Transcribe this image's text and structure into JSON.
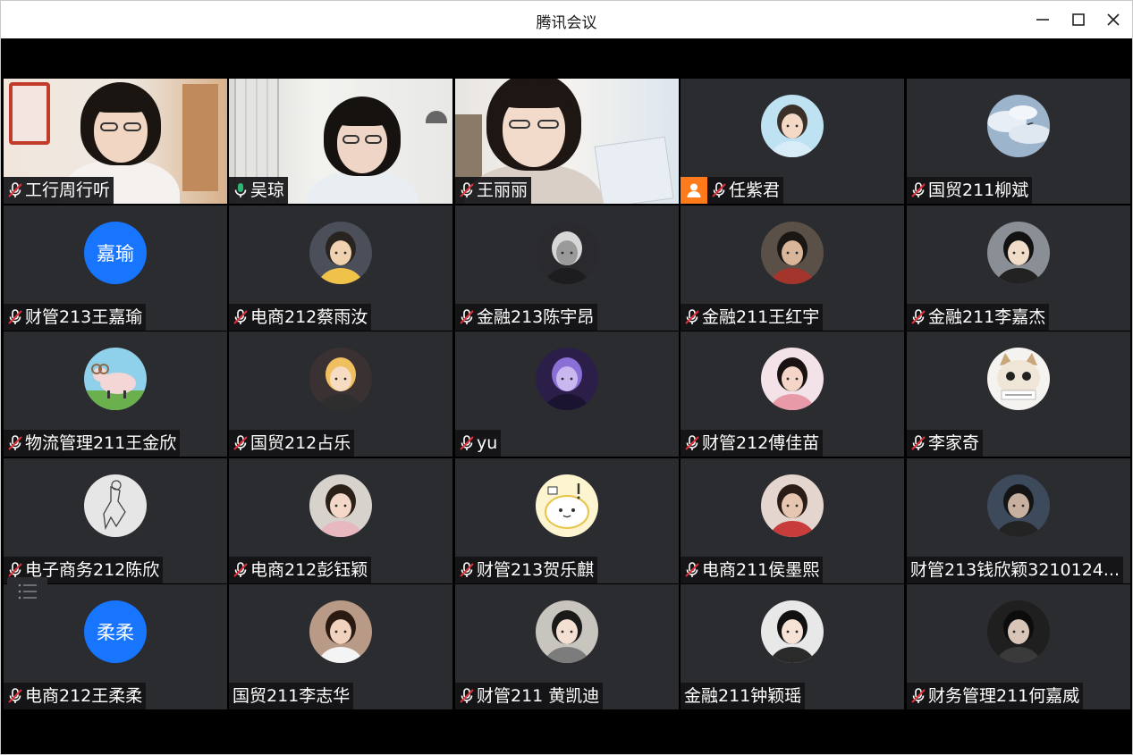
{
  "window": {
    "title": "腾讯会议",
    "controls": {
      "minimize": "minimize-icon",
      "maximize": "maximize-icon",
      "close": "close-icon"
    }
  },
  "colors": {
    "tile_bg": "#2b2c30",
    "stage_bg": "#000000",
    "avatar_blue": "#1775ff",
    "host_orange": "#ff7a1a",
    "speaking_green": "#2bb673",
    "muted_red": "#e0303a"
  },
  "participants": [
    {
      "name": "工行周行听",
      "mic": "muted",
      "media": "video"
    },
    {
      "name": "吴琼",
      "mic": "on",
      "media": "video",
      "speaking": true
    },
    {
      "name": "王丽丽",
      "mic": "muted",
      "media": "video"
    },
    {
      "name": "任紫君",
      "mic": "muted",
      "media": "avatar",
      "host": true
    },
    {
      "name": "国贸211柳斌",
      "mic": "muted",
      "media": "avatar"
    },
    {
      "name": "财管213王嘉瑜",
      "mic": "muted",
      "media": "text-avatar",
      "avatar_text": "嘉瑜"
    },
    {
      "name": "电商212蔡雨汝",
      "mic": "muted",
      "media": "avatar"
    },
    {
      "name": "金融213陈宇昂",
      "mic": "muted",
      "media": "avatar"
    },
    {
      "name": "金融211王红宇",
      "mic": "muted",
      "media": "avatar"
    },
    {
      "name": "金融211李嘉杰",
      "mic": "muted",
      "media": "avatar"
    },
    {
      "name": "物流管理211王金欣",
      "mic": "muted",
      "media": "avatar"
    },
    {
      "name": "国贸212占乐",
      "mic": "muted",
      "media": "avatar"
    },
    {
      "name": "yu",
      "mic": "muted",
      "media": "avatar"
    },
    {
      "name": "财管212傅佳苗",
      "mic": "muted",
      "media": "avatar"
    },
    {
      "name": "李家奇",
      "mic": "muted",
      "media": "avatar"
    },
    {
      "name": "电子商务212陈欣",
      "mic": "muted",
      "media": "avatar"
    },
    {
      "name": "电商212彭钰颖",
      "mic": "muted",
      "media": "avatar"
    },
    {
      "name": "财管213贺乐麒",
      "mic": "muted",
      "media": "avatar"
    },
    {
      "name": "电商211侯墨熙",
      "mic": "muted",
      "media": "avatar"
    },
    {
      "name": "财管213钱欣颖3210124...",
      "mic": "none",
      "media": "avatar"
    },
    {
      "name": "电商212王柔柔",
      "mic": "muted",
      "media": "text-avatar",
      "avatar_text": "柔柔"
    },
    {
      "name": "国贸211李志华",
      "mic": "none",
      "media": "avatar"
    },
    {
      "name": "财管211 黄凯迪",
      "mic": "muted",
      "media": "avatar"
    },
    {
      "name": "金融211钟颖瑶",
      "mic": "none",
      "media": "avatar"
    },
    {
      "name": "财务管理211何嘉威",
      "mic": "muted",
      "media": "avatar"
    }
  ],
  "side_panel_button": {
    "icon": "member-list-icon"
  }
}
